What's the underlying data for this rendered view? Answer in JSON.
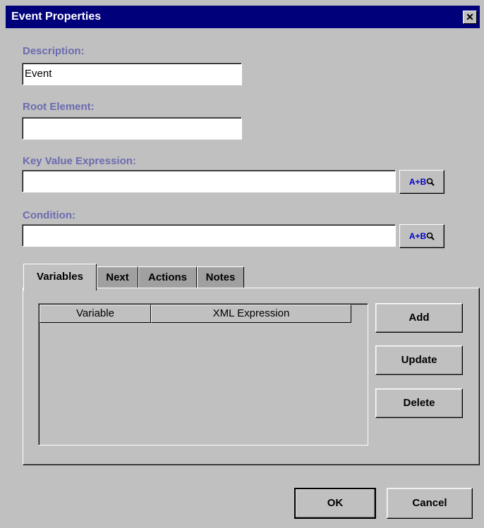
{
  "window": {
    "title": "Event Properties",
    "close_glyph": "✕"
  },
  "form": {
    "description_label": "Description:",
    "description_value": "Event",
    "root_element_label": "Root Element:",
    "root_element_value": "",
    "key_value_label": "Key Value Expression:",
    "key_value_value": "",
    "condition_label": "Condition:",
    "condition_value": "",
    "expr_button_label": "A+B"
  },
  "tabs": [
    {
      "label": "Variables",
      "active": true
    },
    {
      "label": "Next",
      "active": false
    },
    {
      "label": "Actions",
      "active": false
    },
    {
      "label": "Notes",
      "active": false
    }
  ],
  "variables_table": {
    "columns": [
      "Variable",
      "XML Expression"
    ],
    "rows": []
  },
  "side_buttons": {
    "add": "Add",
    "update": "Update",
    "delete": "Delete"
  },
  "footer": {
    "ok": "OK",
    "cancel": "Cancel"
  },
  "colors": {
    "titlebar": "#00007b",
    "label": "#6b6bb0",
    "expr_button_text": "#0000cc",
    "background": "#c0c0c0"
  }
}
